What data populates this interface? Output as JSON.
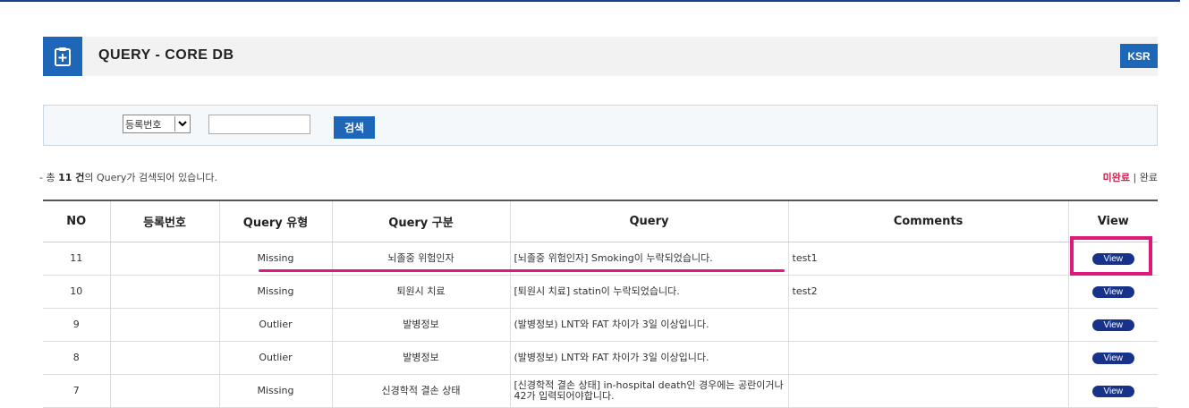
{
  "header": {
    "title": "QUERY - CORE DB",
    "ksr_label": "KSR",
    "icon": "clipboard-plus-icon"
  },
  "search": {
    "select_value": "등록번호",
    "input_value": "",
    "button_label": "검색"
  },
  "summary": {
    "prefix": "- 총 ",
    "count": "11 건",
    "suffix": "의 Query가 검색되어 있습니다."
  },
  "filters": {
    "incomplete": "미완료",
    "separator": "|",
    "complete": "완료"
  },
  "table": {
    "headers": [
      "NO",
      "등록번호",
      "Query 유형",
      "Query 구분",
      "Query",
      "Comments",
      "View"
    ],
    "rows": [
      {
        "no": "11",
        "reg": "",
        "type": "Missing",
        "category": "뇌졸중 위험인자",
        "query": "[뇌졸중 위험인자] Smoking이 누락되었습니다.",
        "comment": "test1",
        "view": "View"
      },
      {
        "no": "10",
        "reg": "",
        "type": "Missing",
        "category": "퇴원시 치료",
        "query": "[퇴원시 치료] statin이 누락되었습니다.",
        "comment": "test2",
        "view": "View"
      },
      {
        "no": "9",
        "reg": "",
        "type": "Outlier",
        "category": "발병정보",
        "query": "(발병정보) LNT와 FAT 차이가 3일 이상입니다.",
        "comment": "",
        "view": "View"
      },
      {
        "no": "8",
        "reg": "",
        "type": "Outlier",
        "category": "발병정보",
        "query": "(발병정보) LNT와 FAT 차이가 3일 이상입니다.",
        "comment": "",
        "view": "View"
      },
      {
        "no": "7",
        "reg": "",
        "type": "Missing",
        "category": "신경학적 결손 상태",
        "query": "[신경학적 결손 상태] in-hospital death인 경우에는 공란이거나 42가 입력되어야합니다.",
        "comment": "",
        "view": "View"
      }
    ]
  },
  "colors": {
    "accent_blue": "#1d66b8",
    "view_button": "#16328a",
    "highlight_pink": "#e0187c",
    "incomplete_link": "#c8264c"
  }
}
